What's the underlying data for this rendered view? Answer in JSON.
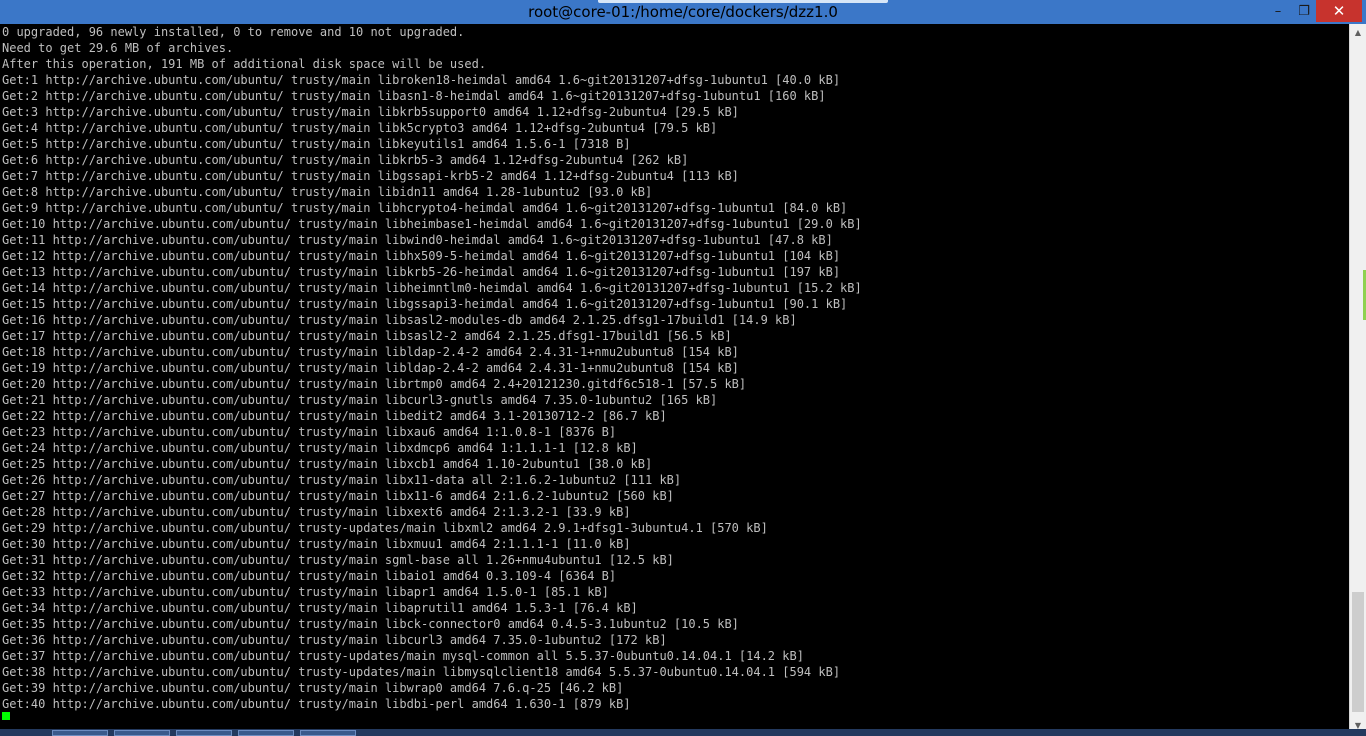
{
  "window": {
    "title": "root@core-01:/home/core/dockers/dzz1.0",
    "buttons": {
      "minimize": "–",
      "maximize": "❐",
      "close": "✕"
    }
  },
  "terminal": {
    "lines": [
      "0 upgraded, 96 newly installed, 0 to remove and 10 not upgraded.",
      "Need to get 29.6 MB of archives.",
      "After this operation, 191 MB of additional disk space will be used.",
      "Get:1 http://archive.ubuntu.com/ubuntu/ trusty/main libroken18-heimdal amd64 1.6~git20131207+dfsg-1ubuntu1 [40.0 kB]",
      "Get:2 http://archive.ubuntu.com/ubuntu/ trusty/main libasn1-8-heimdal amd64 1.6~git20131207+dfsg-1ubuntu1 [160 kB]",
      "Get:3 http://archive.ubuntu.com/ubuntu/ trusty/main libkrb5support0 amd64 1.12+dfsg-2ubuntu4 [29.5 kB]",
      "Get:4 http://archive.ubuntu.com/ubuntu/ trusty/main libk5crypto3 amd64 1.12+dfsg-2ubuntu4 [79.5 kB]",
      "Get:5 http://archive.ubuntu.com/ubuntu/ trusty/main libkeyutils1 amd64 1.5.6-1 [7318 B]",
      "Get:6 http://archive.ubuntu.com/ubuntu/ trusty/main libkrb5-3 amd64 1.12+dfsg-2ubuntu4 [262 kB]",
      "Get:7 http://archive.ubuntu.com/ubuntu/ trusty/main libgssapi-krb5-2 amd64 1.12+dfsg-2ubuntu4 [113 kB]",
      "Get:8 http://archive.ubuntu.com/ubuntu/ trusty/main libidn11 amd64 1.28-1ubuntu2 [93.0 kB]",
      "Get:9 http://archive.ubuntu.com/ubuntu/ trusty/main libhcrypto4-heimdal amd64 1.6~git20131207+dfsg-1ubuntu1 [84.0 kB]",
      "Get:10 http://archive.ubuntu.com/ubuntu/ trusty/main libheimbase1-heimdal amd64 1.6~git20131207+dfsg-1ubuntu1 [29.0 kB]",
      "Get:11 http://archive.ubuntu.com/ubuntu/ trusty/main libwind0-heimdal amd64 1.6~git20131207+dfsg-1ubuntu1 [47.8 kB]",
      "Get:12 http://archive.ubuntu.com/ubuntu/ trusty/main libhx509-5-heimdal amd64 1.6~git20131207+dfsg-1ubuntu1 [104 kB]",
      "Get:13 http://archive.ubuntu.com/ubuntu/ trusty/main libkrb5-26-heimdal amd64 1.6~git20131207+dfsg-1ubuntu1 [197 kB]",
      "Get:14 http://archive.ubuntu.com/ubuntu/ trusty/main libheimntlm0-heimdal amd64 1.6~git20131207+dfsg-1ubuntu1 [15.2 kB]",
      "Get:15 http://archive.ubuntu.com/ubuntu/ trusty/main libgssapi3-heimdal amd64 1.6~git20131207+dfsg-1ubuntu1 [90.1 kB]",
      "Get:16 http://archive.ubuntu.com/ubuntu/ trusty/main libsasl2-modules-db amd64 2.1.25.dfsg1-17build1 [14.9 kB]",
      "Get:17 http://archive.ubuntu.com/ubuntu/ trusty/main libsasl2-2 amd64 2.1.25.dfsg1-17build1 [56.5 kB]",
      "Get:18 http://archive.ubuntu.com/ubuntu/ trusty/main libldap-2.4-2 amd64 2.4.31-1+nmu2ubuntu8 [154 kB]",
      "Get:19 http://archive.ubuntu.com/ubuntu/ trusty/main libldap-2.4-2 amd64 2.4.31-1+nmu2ubuntu8 [154 kB]",
      "Get:20 http://archive.ubuntu.com/ubuntu/ trusty/main librtmp0 amd64 2.4+20121230.gitdf6c518-1 [57.5 kB]",
      "Get:21 http://archive.ubuntu.com/ubuntu/ trusty/main libcurl3-gnutls amd64 7.35.0-1ubuntu2 [165 kB]",
      "Get:22 http://archive.ubuntu.com/ubuntu/ trusty/main libedit2 amd64 3.1-20130712-2 [86.7 kB]",
      "Get:23 http://archive.ubuntu.com/ubuntu/ trusty/main libxau6 amd64 1:1.0.8-1 [8376 B]",
      "Get:24 http://archive.ubuntu.com/ubuntu/ trusty/main libxdmcp6 amd64 1:1.1.1-1 [12.8 kB]",
      "Get:25 http://archive.ubuntu.com/ubuntu/ trusty/main libxcb1 amd64 1.10-2ubuntu1 [38.0 kB]",
      "Get:26 http://archive.ubuntu.com/ubuntu/ trusty/main libx11-data all 2:1.6.2-1ubuntu2 [111 kB]",
      "Get:27 http://archive.ubuntu.com/ubuntu/ trusty/main libx11-6 amd64 2:1.6.2-1ubuntu2 [560 kB]",
      "Get:28 http://archive.ubuntu.com/ubuntu/ trusty/main libxext6 amd64 2:1.3.2-1 [33.9 kB]",
      "Get:29 http://archive.ubuntu.com/ubuntu/ trusty-updates/main libxml2 amd64 2.9.1+dfsg1-3ubuntu4.1 [570 kB]",
      "Get:30 http://archive.ubuntu.com/ubuntu/ trusty/main libxmuu1 amd64 2:1.1.1-1 [11.0 kB]",
      "Get:31 http://archive.ubuntu.com/ubuntu/ trusty/main sgml-base all 1.26+nmu4ubuntu1 [12.5 kB]",
      "Get:32 http://archive.ubuntu.com/ubuntu/ trusty/main libaio1 amd64 0.3.109-4 [6364 B]",
      "Get:33 http://archive.ubuntu.com/ubuntu/ trusty/main libapr1 amd64 1.5.0-1 [85.1 kB]",
      "Get:34 http://archive.ubuntu.com/ubuntu/ trusty/main libaprutil1 amd64 1.5.3-1 [76.4 kB]",
      "Get:35 http://archive.ubuntu.com/ubuntu/ trusty/main libck-connector0 amd64 0.4.5-3.1ubuntu2 [10.5 kB]",
      "Get:36 http://archive.ubuntu.com/ubuntu/ trusty/main libcurl3 amd64 7.35.0-1ubuntu2 [172 kB]",
      "Get:37 http://archive.ubuntu.com/ubuntu/ trusty-updates/main mysql-common all 5.5.37-0ubuntu0.14.04.1 [14.2 kB]",
      "Get:38 http://archive.ubuntu.com/ubuntu/ trusty-updates/main libmysqlclient18 amd64 5.5.37-0ubuntu0.14.04.1 [594 kB]",
      "Get:39 http://archive.ubuntu.com/ubuntu/ trusty/main libwrap0 amd64 7.6.q-25 [46.2 kB]",
      "Get:40 http://archive.ubuntu.com/ubuntu/ trusty/main libdbi-perl amd64 1.630-1 [879 kB]"
    ]
  },
  "colors": {
    "titlebar": "#3b77c8",
    "terminal_bg": "#000000",
    "terminal_text": "#bfbfbf",
    "cursor": "#00ff00",
    "close_button": "#c7332d"
  },
  "icons": {
    "scroll_up": "scroll-up-arrow-icon",
    "scroll_down": "scroll-down-arrow-icon"
  }
}
